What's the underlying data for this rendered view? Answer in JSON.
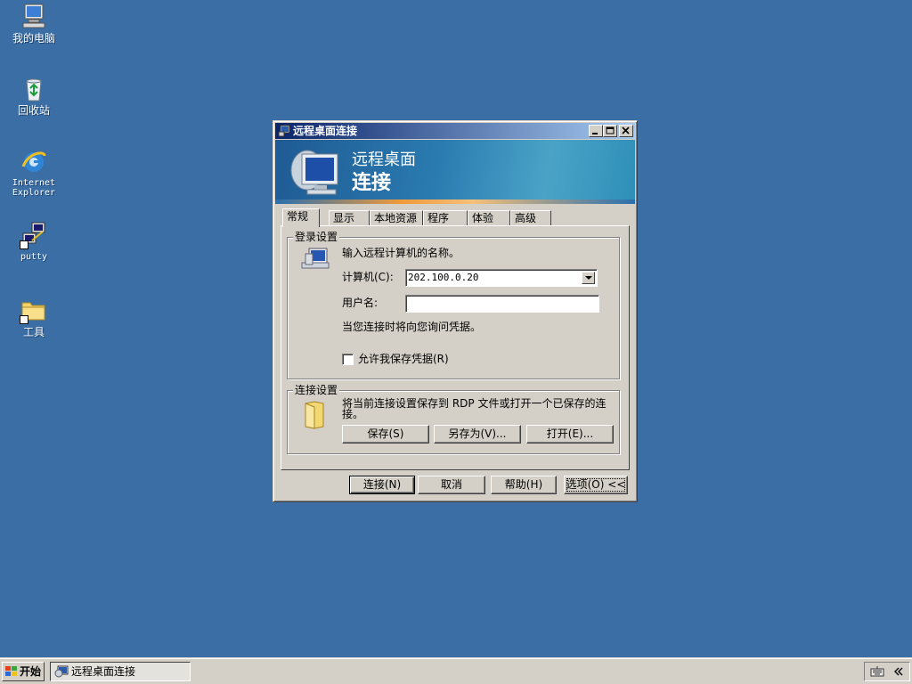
{
  "desktop": {
    "icons": [
      {
        "label": "我的电脑",
        "icon": "my-computer-icon"
      },
      {
        "label": "回收站",
        "icon": "recycle-bin-icon"
      },
      {
        "label_line1": "Internet",
        "label_line2": "Explorer",
        "icon": "internet-explorer-icon"
      },
      {
        "label": "putty",
        "icon": "putty-icon"
      },
      {
        "label": "工具",
        "icon": "folder-icon"
      }
    ]
  },
  "window": {
    "title": "远程桌面连接",
    "banner": {
      "line1": "远程桌面",
      "line2": "连接"
    },
    "tabs": [
      {
        "label": "常规",
        "active": true
      },
      {
        "label": "显示"
      },
      {
        "label": "本地资源"
      },
      {
        "label": "程序"
      },
      {
        "label": "体验"
      },
      {
        "label": "高级"
      }
    ],
    "login_group": {
      "legend": "登录设置",
      "prompt": "输入远程计算机的名称。",
      "computer_label": "计算机(C):",
      "computer_value": "202.100.0.20",
      "username_label": "用户名:",
      "username_value": "",
      "note": "当您连接时将向您询问凭据。",
      "save_credentials_label": "允许我保存凭据(R)",
      "save_credentials_checked": false
    },
    "connection_group": {
      "legend": "连接设置",
      "description": "将当前连接设置保存到 RDP 文件或打开一个已保存的连接。",
      "save_label": "保存(S)",
      "save_as_label": "另存为(V)...",
      "open_label": "打开(E)..."
    },
    "buttons": {
      "connect": "连接(N)",
      "cancel": "取消",
      "help": "帮助(H)",
      "options": "选项(O) <<"
    }
  },
  "taskbar": {
    "start_label": "开始",
    "task_label": "远程桌面连接"
  },
  "colors": {
    "desktop": "#3a6ea5",
    "titlebar_start": "#0a246a",
    "titlebar_end": "#a6caf0",
    "face": "#d4d0c8"
  }
}
